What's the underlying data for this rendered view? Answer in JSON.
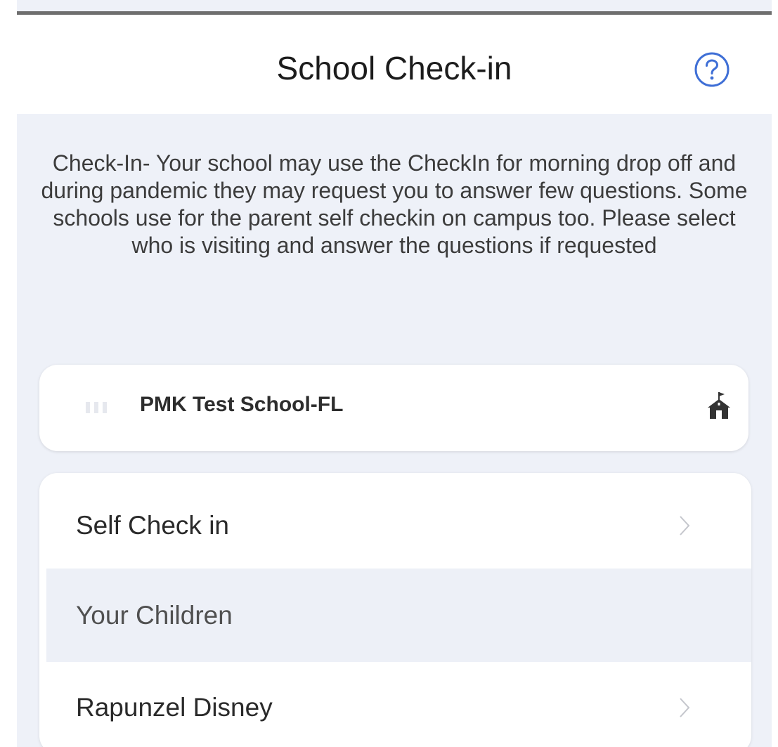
{
  "header": {
    "title": "School Check-in",
    "help_icon": "help-circle-icon"
  },
  "description": "Check-In- Your school may use the CheckIn for morning drop off and during pandemic they may request you to answer few questions. Some schools use for the parent self checkin on campus too. Please select who is visiting and answer the questions if requested",
  "school": {
    "name": "PMK Test School-FL",
    "icon": "school-building-icon"
  },
  "list": {
    "self_check_in": "Self Check in",
    "section_header": "Your Children",
    "children": [
      "Rapunzel Disney"
    ]
  },
  "colors": {
    "accent": "#3f6fd6",
    "background": "#eef1f8",
    "card": "#ffffff",
    "section_header_bg": "#edf0f7"
  }
}
